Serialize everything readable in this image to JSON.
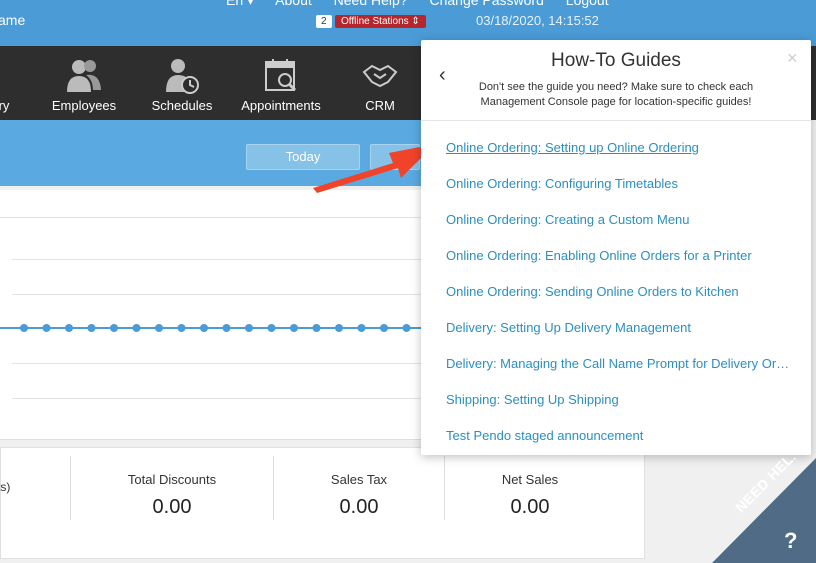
{
  "topbar": {
    "name_fragment": "ame",
    "links": [
      "En ▾",
      "About",
      "Need Help?",
      "Change Password",
      "Logout"
    ],
    "offline_count": "2",
    "offline_label": "Offline Stations ⇕",
    "datetime": "03/18/2020, 14:15:52"
  },
  "nav": {
    "items": [
      {
        "label": "ry",
        "icon": "partial-icon"
      },
      {
        "label": "Employees",
        "icon": "users-icon"
      },
      {
        "label": "Schedules",
        "icon": "user-clock-icon"
      },
      {
        "label": "Appointments",
        "icon": "calendar-search-icon"
      },
      {
        "label": "CRM",
        "icon": "handshake-icon"
      }
    ]
  },
  "filter": {
    "today_label": "Today"
  },
  "stats": {
    "left_fragment": "ts)",
    "items": [
      {
        "title": "Total Discounts",
        "value": "0.00"
      },
      {
        "title": "Sales Tax",
        "value": "0.00"
      },
      {
        "title": "Net Sales",
        "value": "0.00"
      }
    ]
  },
  "panel": {
    "title": "How-To Guides",
    "subtitle": "Don't see the guide you need? Make sure to check each Management Console page for location-specific guides!",
    "back_glyph": "‹",
    "close_glyph": "×",
    "guides": [
      "Online Ordering: Setting up Online Ordering",
      "Online Ordering: Configuring Timetables",
      "Online Ordering: Creating a Custom Menu",
      "Online Ordering: Enabling Online Orders for a Printer",
      "Online Ordering: Sending Online Orders to Kitchen",
      "Delivery: Setting Up Delivery Management",
      "Delivery: Managing the Call Name Prompt for Delivery Orders",
      "Shipping: Setting Up Shipping",
      "Test Pendo staged announcement"
    ]
  },
  "help_ribbon": {
    "label": "NEED HELP",
    "glyph": "?"
  },
  "colors": {
    "topbar": "#4a9bd6",
    "nav": "#2e2e2e",
    "link": "#2a8fbf",
    "arrow": "#f0432a",
    "offline_badge": "#b5272d",
    "ribbon": "#4f6b86"
  }
}
